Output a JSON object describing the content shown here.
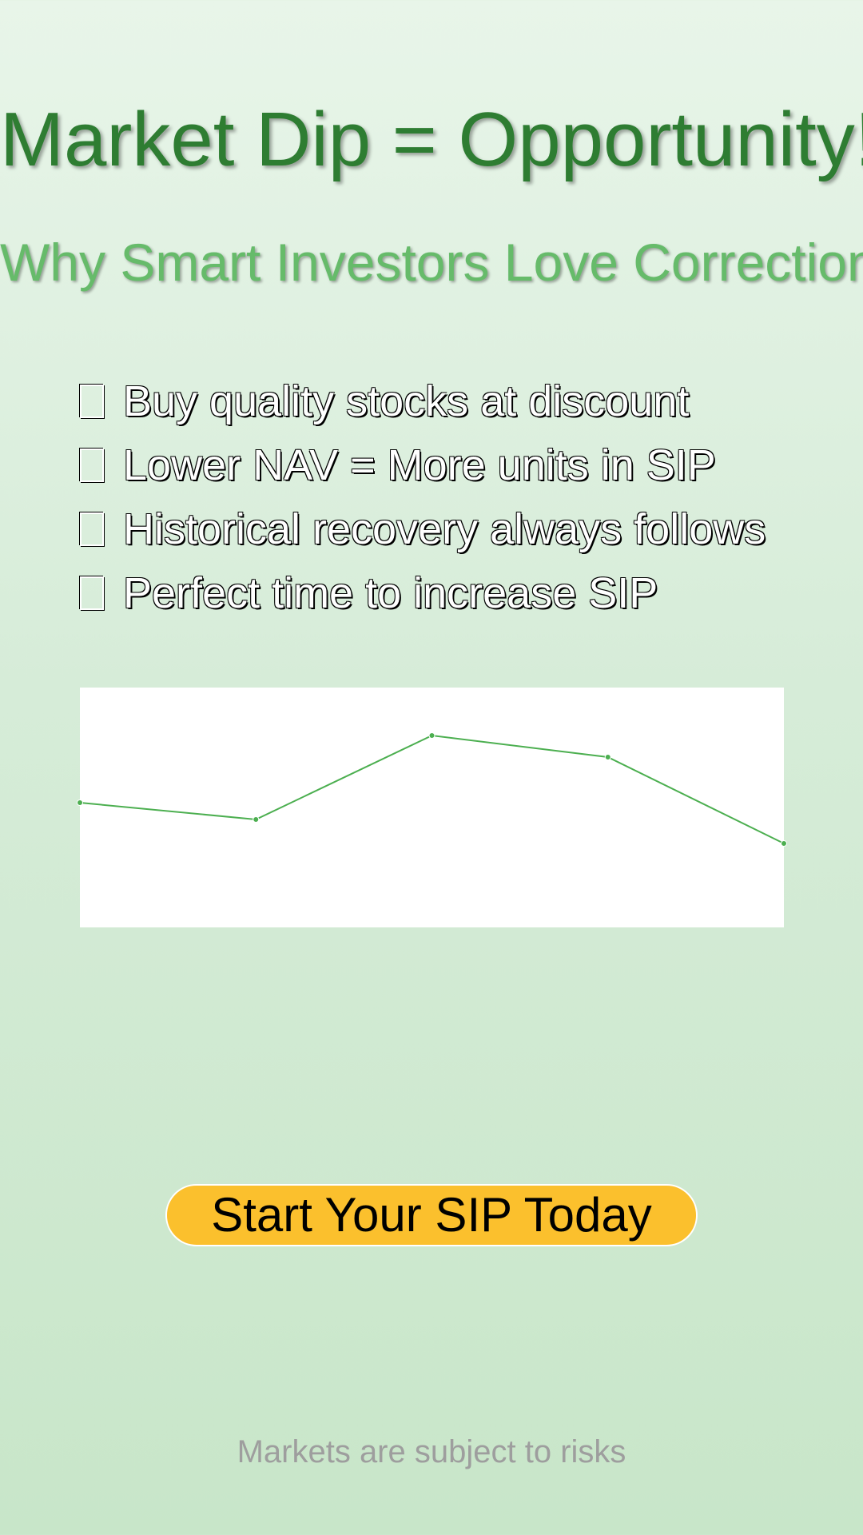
{
  "title": "Market Dip = Opportunity!",
  "subtitle": "Why Smart Investors Love Corrections",
  "bullets": [
    {
      "icon": "checkbox-icon",
      "text": "Buy quality stocks at discount"
    },
    {
      "icon": "checkbox-icon",
      "text": "Lower NAV = More units in SIP"
    },
    {
      "icon": "checkbox-icon",
      "text": "Historical recovery always follows"
    },
    {
      "icon": "checkbox-icon",
      "text": "Perfect time to increase SIP"
    }
  ],
  "chart_data": {
    "type": "line",
    "x": [
      1,
      2,
      3,
      4,
      5
    ],
    "series": [
      {
        "values": [
          52,
          45,
          80,
          71,
          35
        ]
      }
    ],
    "ylim": [
      0,
      100
    ],
    "grid": false,
    "color": "#4caf50"
  },
  "cta": {
    "label": "Start Your SIP Today"
  },
  "footer": "Markets are subject to risks",
  "colors": {
    "title": "#2e7d32",
    "subtitle": "#66bb6a",
    "cta_background": "#fbc02d",
    "footer": "#9e9e9e"
  }
}
